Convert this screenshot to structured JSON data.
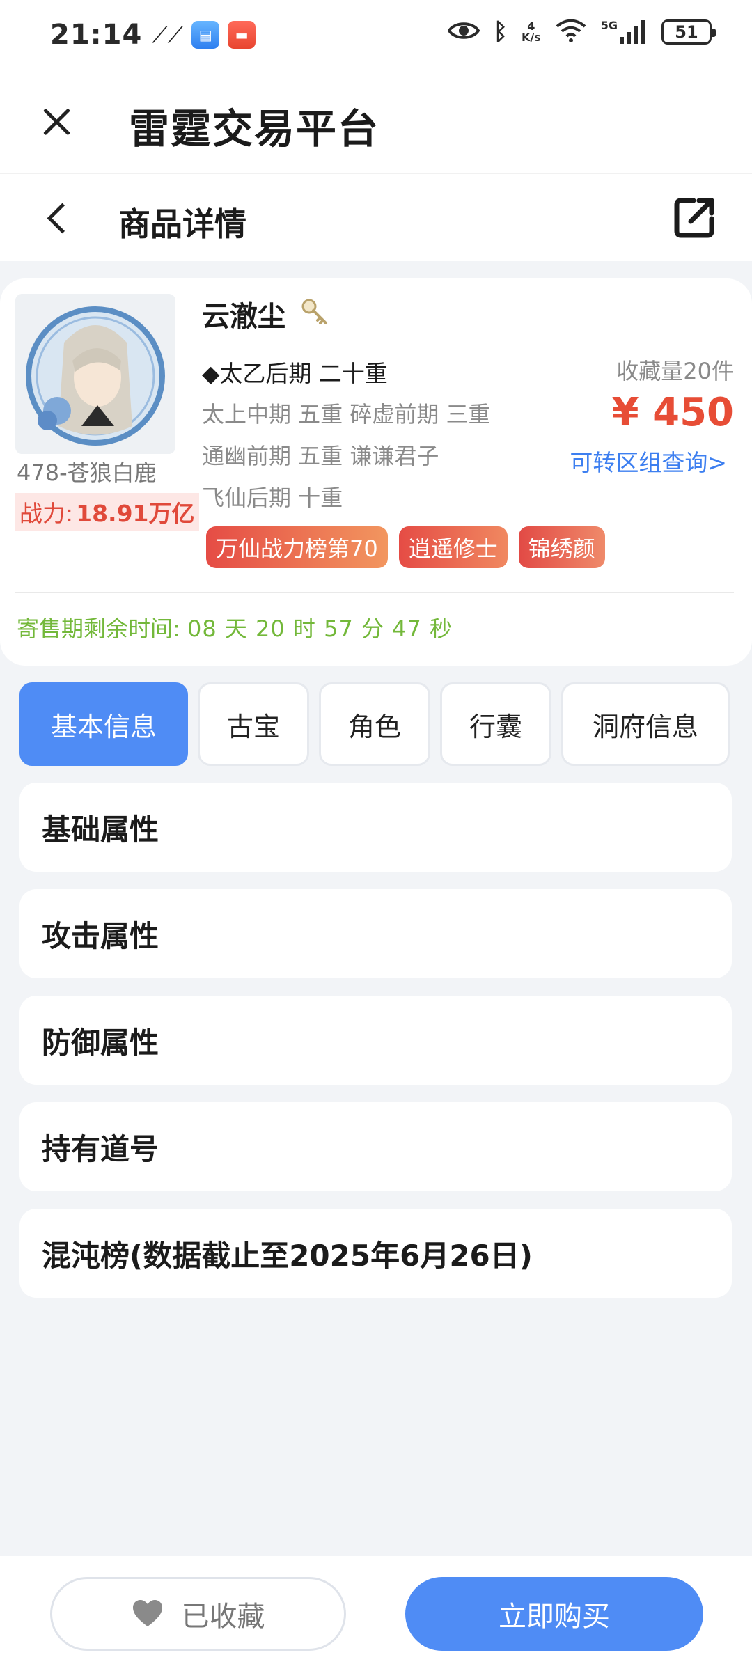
{
  "status_bar": {
    "time": "21:14",
    "network_speed_value": "4",
    "network_speed_unit": "K/s",
    "network_type": "5G",
    "battery": "51"
  },
  "app_header": {
    "title": "雷霆交易平台"
  },
  "page_header": {
    "title": "商品详情"
  },
  "product": {
    "name": "云澈尘",
    "server": "478-苍狼白鹿",
    "power_label": "战力:",
    "power_value": "18.91万亿",
    "realm_main": "◆太乙后期 二十重",
    "realms": [
      "太上中期 五重 碎虚前期 三重",
      "通幽前期 五重 谦谦君子",
      "飞仙后期 十重"
    ],
    "collect_count": "收藏量20件",
    "price": "¥ 450",
    "transfer_link": "可转区组查询>",
    "tags": [
      "万仙战力榜第70",
      "逍遥修士",
      "锦绣颜"
    ],
    "countdown_label": "寄售期剩余时间:",
    "countdown_value": "08 天 20 时 57 分 47 秒"
  },
  "tabs": [
    {
      "label": "基本信息",
      "active": true
    },
    {
      "label": "古宝",
      "active": false
    },
    {
      "label": "角色",
      "active": false
    },
    {
      "label": "行囊",
      "active": false
    },
    {
      "label": "洞府信息",
      "active": false
    }
  ],
  "sections": [
    "基础属性",
    "攻击属性",
    "防御属性",
    "持有道号",
    "混沌榜(数据截止至2025年6月26日)"
  ],
  "bottom": {
    "favorite_label": "已收藏",
    "buy_label": "立即购买"
  },
  "colors": {
    "accent_blue": "#4f8cf5",
    "price_red": "#e74d36",
    "countdown_green": "#73b83a",
    "link_blue": "#3d7ff0"
  }
}
